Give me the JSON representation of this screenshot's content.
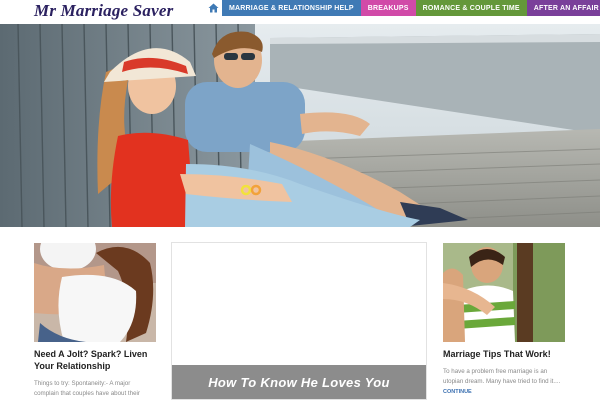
{
  "site": {
    "logo": "Mr Marriage Saver"
  },
  "nav": {
    "home_icon": "home-icon",
    "items": [
      {
        "label": "Marriage & Relationship Help",
        "color": "#3f7ab5"
      },
      {
        "label": "Breakups",
        "color": "#d14aa8"
      },
      {
        "label": "Romance & Couple Time",
        "color": "#64983a"
      },
      {
        "label": "After An Affair",
        "color": "#7a3f9a"
      }
    ]
  },
  "posts": {
    "left": {
      "title": "Need A Jolt? Spark? Liven Your Relationship",
      "excerpt": "Things to try: Spontaneity:- A major complain that couples have about their"
    },
    "middle": {
      "banner": "How To Know He Loves You"
    },
    "right": {
      "title": "Marriage Tips That Work!",
      "excerpt": "To have a problem free marriage is an utopian dream. Many have tried to find it....",
      "more": "CONTINUE"
    }
  }
}
